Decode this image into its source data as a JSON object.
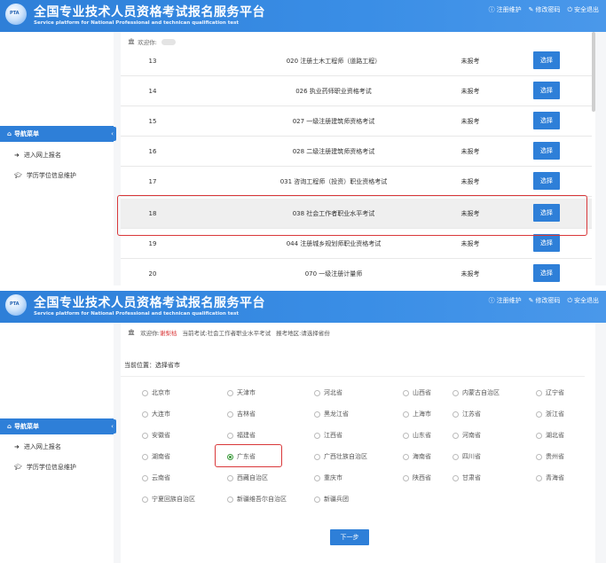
{
  "header": {
    "logo_text": "PTA",
    "title": "全国专业技术人员资格考试报名服务平台",
    "subtitle": "Service platform for National Professional and technican qualification test",
    "links": [
      "注册维护",
      "修改密码",
      "安全退出"
    ]
  },
  "sidebar": {
    "header_label": "导航菜单",
    "collapse_glyph": "‹",
    "items": [
      "进入网上报名",
      "学历学位信息维护"
    ]
  },
  "screen1": {
    "welcome_label": "欢迎你:",
    "status_label": "未报考",
    "select_label": "选择",
    "rows": [
      {
        "num": "13",
        "name": "020 注册土木工程师（道路工程）"
      },
      {
        "num": "14",
        "name": "026 执业药师职业资格考试"
      },
      {
        "num": "15",
        "name": "027 一级注册建筑师资格考试"
      },
      {
        "num": "16",
        "name": "028 二级注册建筑师资格考试"
      },
      {
        "num": "17",
        "name": "031 咨询工程师（投资）职业资格考试"
      },
      {
        "num": "18",
        "name": "038 社会工作者职业水平考试"
      },
      {
        "num": "19",
        "name": "044 注册城乡规划师职业资格考试"
      },
      {
        "num": "20",
        "name": "070 一级注册计量师"
      }
    ]
  },
  "screen2": {
    "welcome_label": "欢迎你:",
    "user_name": "谢梨枯",
    "current_exam_label": "当前考试:",
    "current_exam": "社会工作者职业水平考试",
    "region_label": "报考地区:",
    "region_value": "请选择省份",
    "location_label": "当前位置：选择省市",
    "provinces": [
      [
        "北京市",
        "天津市",
        "河北省",
        "山西省",
        "内蒙古自治区",
        "辽宁省"
      ],
      [
        "大连市",
        "吉林省",
        "黑龙江省",
        "上海市",
        "江苏省",
        "浙江省"
      ],
      [
        "安徽省",
        "福建省",
        "江西省",
        "山东省",
        "河南省",
        "湖北省"
      ],
      [
        "湖南省",
        "广东省",
        "广西壮族自治区",
        "海南省",
        "四川省",
        "贵州省"
      ],
      [
        "云南省",
        "西藏自治区",
        "重庆市",
        "陕西省",
        "甘肃省",
        "青海省"
      ],
      [
        "宁夏回族自治区",
        "新疆维吾尔自治区",
        "新疆兵团"
      ]
    ],
    "selected_province": "广东省",
    "next_label": "下一步"
  },
  "colors": {
    "brand_blue": "#2e7fd8",
    "highlight_red": "#d9383a",
    "radio_selected": "#3a9a3a"
  }
}
